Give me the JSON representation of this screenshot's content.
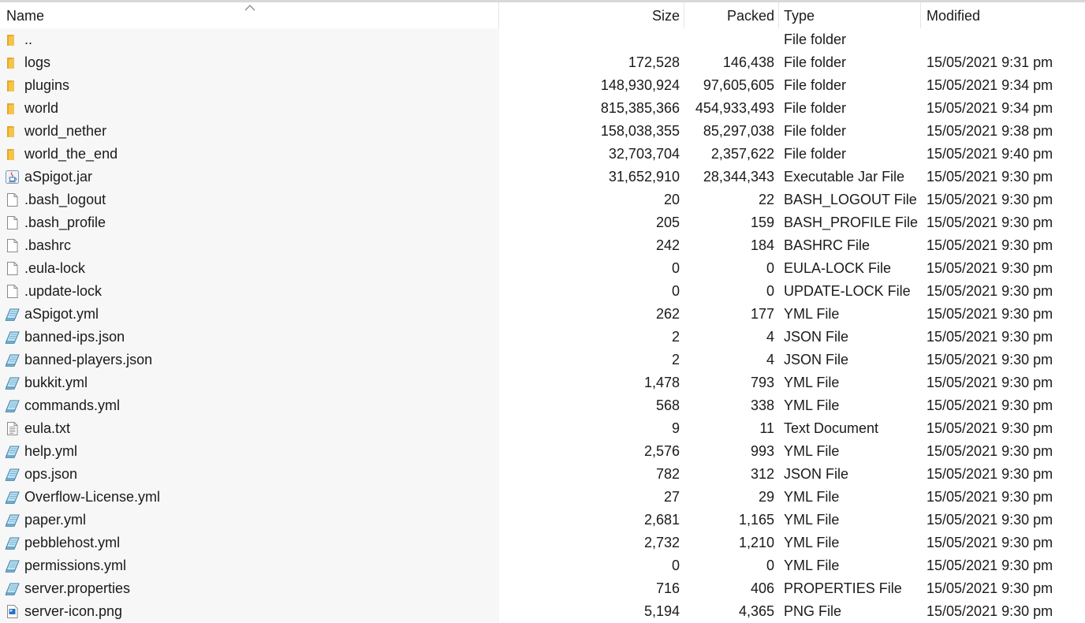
{
  "columns": {
    "name": "Name",
    "size": "Size",
    "packed": "Packed",
    "type": "Type",
    "modified": "Modified"
  },
  "rows": [
    {
      "icon": "folder-icon",
      "name": "..",
      "size": "",
      "packed": "",
      "type": "File folder",
      "modified": ""
    },
    {
      "icon": "folder-icon",
      "name": "logs",
      "size": "172,528",
      "packed": "146,438",
      "type": "File folder",
      "modified": "15/05/2021 9:31 pm"
    },
    {
      "icon": "folder-icon",
      "name": "plugins",
      "size": "148,930,924",
      "packed": "97,605,605",
      "type": "File folder",
      "modified": "15/05/2021 9:34 pm"
    },
    {
      "icon": "folder-icon",
      "name": "world",
      "size": "815,385,366",
      "packed": "454,933,493",
      "type": "File folder",
      "modified": "15/05/2021 9:34 pm"
    },
    {
      "icon": "folder-icon",
      "name": "world_nether",
      "size": "158,038,355",
      "packed": "85,297,038",
      "type": "File folder",
      "modified": "15/05/2021 9:38 pm"
    },
    {
      "icon": "folder-icon",
      "name": "world_the_end",
      "size": "32,703,704",
      "packed": "2,357,622",
      "type": "File folder",
      "modified": "15/05/2021 9:40 pm"
    },
    {
      "icon": "java-jar-icon",
      "name": "aSpigot.jar",
      "size": "31,652,910",
      "packed": "28,344,343",
      "type": "Executable Jar File",
      "modified": "15/05/2021 9:30 pm"
    },
    {
      "icon": "blank-file-icon",
      "name": ".bash_logout",
      "size": "20",
      "packed": "22",
      "type": "BASH_LOGOUT File",
      "modified": "15/05/2021 9:30 pm"
    },
    {
      "icon": "blank-file-icon",
      "name": ".bash_profile",
      "size": "205",
      "packed": "159",
      "type": "BASH_PROFILE File",
      "modified": "15/05/2021 9:30 pm"
    },
    {
      "icon": "blank-file-icon",
      "name": ".bashrc",
      "size": "242",
      "packed": "184",
      "type": "BASHRC File",
      "modified": "15/05/2021 9:30 pm"
    },
    {
      "icon": "blank-file-icon",
      "name": ".eula-lock",
      "size": "0",
      "packed": "0",
      "type": "EULA-LOCK File",
      "modified": "15/05/2021 9:30 pm"
    },
    {
      "icon": "blank-file-icon",
      "name": ".update-lock",
      "size": "0",
      "packed": "0",
      "type": "UPDATE-LOCK File",
      "modified": "15/05/2021 9:30 pm"
    },
    {
      "icon": "notepad-file-icon",
      "name": "aSpigot.yml",
      "size": "262",
      "packed": "177",
      "type": "YML File",
      "modified": "15/05/2021 9:30 pm"
    },
    {
      "icon": "notepad-file-icon",
      "name": "banned-ips.json",
      "size": "2",
      "packed": "4",
      "type": "JSON File",
      "modified": "15/05/2021 9:30 pm"
    },
    {
      "icon": "notepad-file-icon",
      "name": "banned-players.json",
      "size": "2",
      "packed": "4",
      "type": "JSON File",
      "modified": "15/05/2021 9:30 pm"
    },
    {
      "icon": "notepad-file-icon",
      "name": "bukkit.yml",
      "size": "1,478",
      "packed": "793",
      "type": "YML File",
      "modified": "15/05/2021 9:30 pm"
    },
    {
      "icon": "notepad-file-icon",
      "name": "commands.yml",
      "size": "568",
      "packed": "338",
      "type": "YML File",
      "modified": "15/05/2021 9:30 pm"
    },
    {
      "icon": "text-document-icon",
      "name": "eula.txt",
      "size": "9",
      "packed": "11",
      "type": "Text Document",
      "modified": "15/05/2021 9:30 pm"
    },
    {
      "icon": "notepad-file-icon",
      "name": "help.yml",
      "size": "2,576",
      "packed": "993",
      "type": "YML File",
      "modified": "15/05/2021 9:30 pm"
    },
    {
      "icon": "notepad-file-icon",
      "name": "ops.json",
      "size": "782",
      "packed": "312",
      "type": "JSON File",
      "modified": "15/05/2021 9:30 pm"
    },
    {
      "icon": "notepad-file-icon",
      "name": "Overflow-License.yml",
      "size": "27",
      "packed": "29",
      "type": "YML File",
      "modified": "15/05/2021 9:30 pm"
    },
    {
      "icon": "notepad-file-icon",
      "name": "paper.yml",
      "size": "2,681",
      "packed": "1,165",
      "type": "YML File",
      "modified": "15/05/2021 9:30 pm"
    },
    {
      "icon": "notepad-file-icon",
      "name": "pebblehost.yml",
      "size": "2,732",
      "packed": "1,210",
      "type": "YML File",
      "modified": "15/05/2021 9:30 pm"
    },
    {
      "icon": "notepad-file-icon",
      "name": "permissions.yml",
      "size": "0",
      "packed": "0",
      "type": "YML File",
      "modified": "15/05/2021 9:30 pm"
    },
    {
      "icon": "notepad-file-icon",
      "name": "server.properties",
      "size": "716",
      "packed": "406",
      "type": "PROPERTIES File",
      "modified": "15/05/2021 9:30 pm"
    },
    {
      "icon": "image-file-icon",
      "name": "server-icon.png",
      "size": "5,194",
      "packed": "4,365",
      "type": "PNG File",
      "modified": "15/05/2021 9:30 pm"
    }
  ],
  "sort": {
    "column": "name",
    "direction": "ascending",
    "indicator_icon": "sort-up-chevron-icon"
  },
  "colors": {
    "folder": "#f5c54a",
    "folder_dark": "#e0a82e",
    "name_column_highlight": "#f7f7f7",
    "header_separator": "#e5e5e5"
  }
}
